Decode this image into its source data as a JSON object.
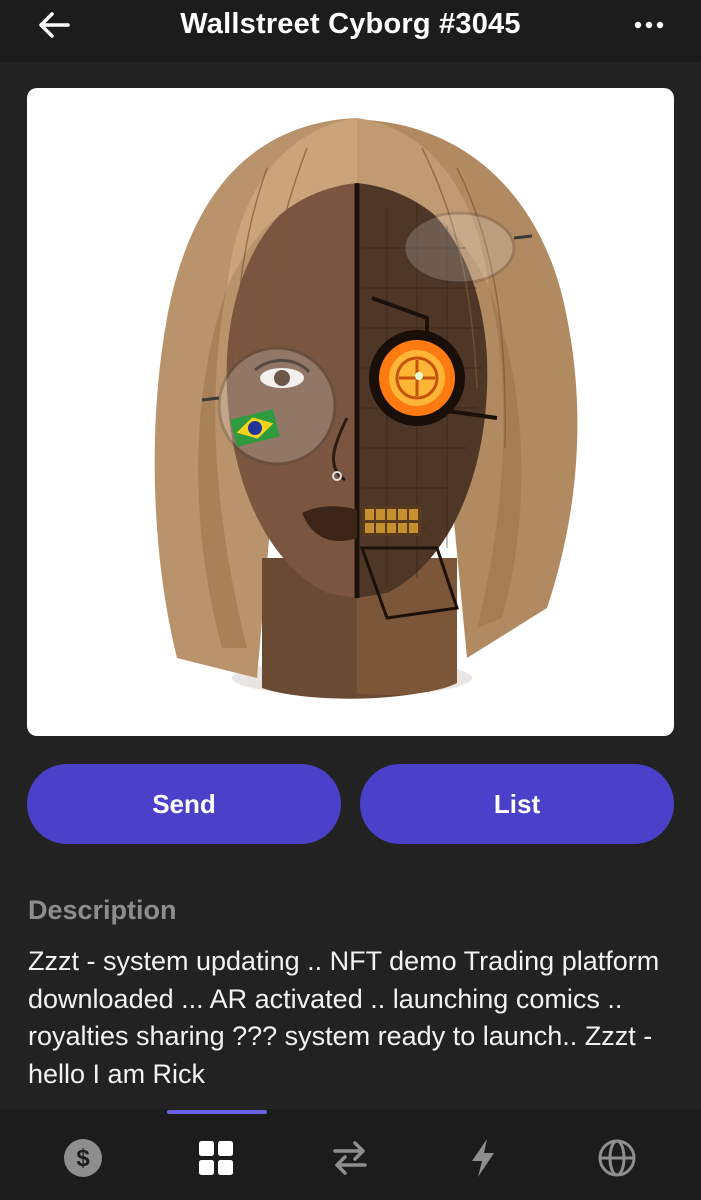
{
  "header": {
    "title": "Wallstreet Cyborg #3045",
    "back_icon": "arrow-left-icon",
    "more_icon": "more-horizontal-icon"
  },
  "nft": {
    "image_alt": "Illustrated portrait of a woman with a bob haircut, half human and half cyborg, wearing round glasses with a Brazilian flag reflection and a glowing orange coin eye"
  },
  "actions": {
    "send_label": "Send",
    "list_label": "List"
  },
  "description": {
    "heading": "Description",
    "text": "Zzzt - system updating .. NFT demo Trading platform downloaded ... AR activated .. launching comics .. royalties sharing ??? system ready to launch.. Zzzt - hello I am Rick"
  },
  "tabbar": {
    "active_tab": "collectibles",
    "tabs": [
      {
        "id": "wallet",
        "icon": "dollar-coin-icon"
      },
      {
        "id": "collectibles",
        "icon": "grid-icon"
      },
      {
        "id": "swap",
        "icon": "swap-arrows-icon"
      },
      {
        "id": "activity",
        "icon": "lightning-icon"
      },
      {
        "id": "browser",
        "icon": "globe-icon"
      }
    ]
  },
  "colors": {
    "background": "#222222",
    "bar": "#1c1c1c",
    "accent": "#4b40c9",
    "indicator": "#6d61e6",
    "muted": "#8d8d8d"
  }
}
